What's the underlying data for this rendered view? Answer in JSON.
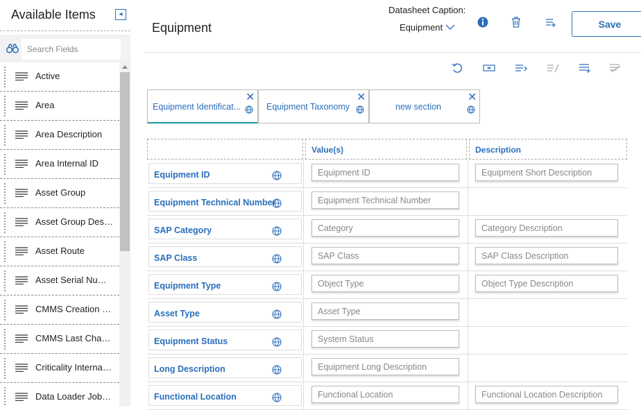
{
  "left_panel": {
    "title": "Available Items",
    "search_placeholder": "Search Fields",
    "items": [
      {
        "label": "Active"
      },
      {
        "label": "Area"
      },
      {
        "label": "Area Description"
      },
      {
        "label": "Area Internal ID"
      },
      {
        "label": "Asset Group"
      },
      {
        "label": "Asset Group Descr..."
      },
      {
        "label": "Asset Route"
      },
      {
        "label": "Asset Serial Numb..."
      },
      {
        "label": "CMMS Creation Da..."
      },
      {
        "label": "CMMS Last Chang..."
      },
      {
        "label": "Criticality Internal ..."
      },
      {
        "label": "Data Loader Job G..."
      }
    ]
  },
  "header": {
    "page_title": "Equipment",
    "caption_label": "Datasheet Caption:",
    "caption_value": "Equipment",
    "save_label": "Save"
  },
  "tabs": [
    {
      "label": "Equipment Identificat...",
      "active": true
    },
    {
      "label": "Equipment Taxonomy",
      "active": false
    },
    {
      "label": "new section",
      "active": false
    }
  ],
  "grid": {
    "headers": {
      "values": "Value(s)",
      "description": "Description"
    },
    "rows": [
      {
        "field": "Equipment ID",
        "value": "Equipment ID",
        "description": "Equipment Short Description"
      },
      {
        "field": "Equipment Technical Number",
        "value": "Equipment Technical Number",
        "description": null
      },
      {
        "field": "SAP Category",
        "value": "Category",
        "description": "Category Description"
      },
      {
        "field": "SAP Class",
        "value": "SAP Class",
        "description": "SAP Class Description"
      },
      {
        "field": "Equipment Type",
        "value": "Object Type",
        "description": "Object Type Description"
      },
      {
        "field": "Asset Type",
        "value": "Asset Type",
        "description": null
      },
      {
        "field": "Equipment Status",
        "value": "System Status",
        "description": null
      },
      {
        "field": "Long Description",
        "value": "Equipment Long Description",
        "description": null
      },
      {
        "field": "Functional Location",
        "value": "Functional Location",
        "description": "Functional Location Description"
      }
    ]
  },
  "colors": {
    "accent": "#2a6ebb",
    "tab_underline": "#1a9a9a"
  }
}
